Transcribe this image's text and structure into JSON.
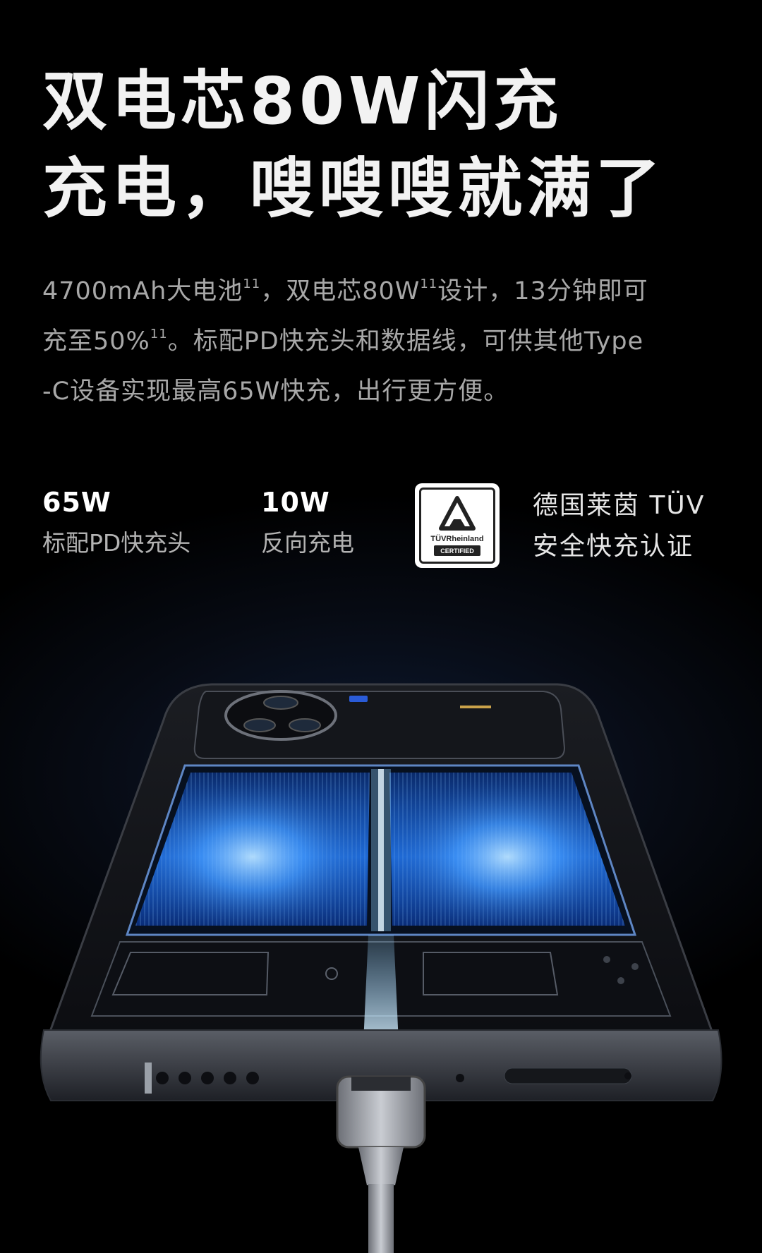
{
  "headline": {
    "line1": "双电芯80W闪充",
    "line2": "充电，嗖嗖嗖就满了"
  },
  "description": {
    "line1_a": "4700mAh大电池",
    "line1_sup1": "11",
    "line1_b": "，双电芯80W",
    "line1_sup2": "11",
    "line1_c": "设计，13分钟即可",
    "line2_a": "充至50%",
    "line2_sup": "11",
    "line2_b": "。标配PD快充头和数据线，可供其他Type",
    "line3": "-C设备实现最高65W快充，出行更方便。"
  },
  "specs": [
    {
      "value": "65W",
      "label": "标配PD快充头"
    },
    {
      "value": "10W",
      "label": "反向充电"
    }
  ],
  "certification": {
    "badge_brand": "TÜVRheinland",
    "badge_status": "CERTIFIED",
    "text_line1": "德国莱茵 TÜV",
    "text_line2": "安全快充认证"
  },
  "visual": {
    "icon": "phone-battery-charging-illustration",
    "accent": "#2e8cff",
    "glow": "#8fd0ff"
  }
}
